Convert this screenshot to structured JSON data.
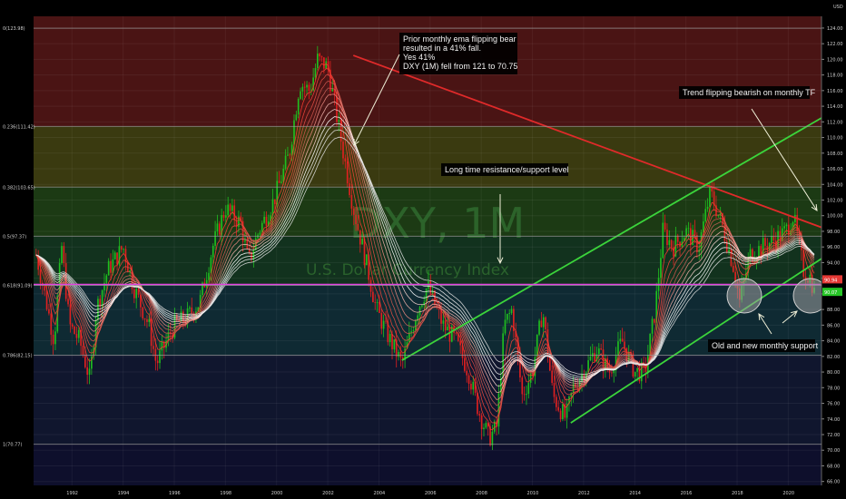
{
  "chart_data": {
    "type": "candlestick",
    "symbol": "DXY, 1M",
    "name": "U.S. Dollar Currency Index",
    "currency": "USD",
    "xlim": [
      1990.5,
      2021.3
    ],
    "ylim": [
      65.5,
      125.5
    ],
    "x_ticks": [
      "1992",
      "1994",
      "1996",
      "1998",
      "2000",
      "2002",
      "2004",
      "2006",
      "2008",
      "2010",
      "2012",
      "2014",
      "2016",
      "2018",
      "2020"
    ],
    "y_ticks": [
      "124.00",
      "122.00",
      "120.00",
      "118.00",
      "116.00",
      "114.00",
      "112.00",
      "110.00",
      "108.00",
      "106.00",
      "104.00",
      "102.00",
      "100.00",
      "98.00",
      "96.00",
      "94.00",
      "92.00",
      "90.00",
      "88.00",
      "86.00",
      "84.00",
      "82.00",
      "80.00",
      "78.00",
      "76.00",
      "74.00",
      "72.00",
      "70.00",
      "68.00",
      "66.00"
    ],
    "fib_levels": [
      {
        "label": "0(123.98)",
        "value": 123.98,
        "color": "#4a1414"
      },
      {
        "label": "0.236(111.42)",
        "value": 111.42,
        "color": "#3a3a10"
      },
      {
        "label": "0.382(103.65)",
        "value": 103.65,
        "color": "#1c3a14"
      },
      {
        "label": "0.5(97.37)",
        "value": 97.37,
        "color": "#12321e"
      },
      {
        "label": "0.618(91.09)",
        "value": 91.09,
        "color": "#0f2a33"
      },
      {
        "label": "0.786(82.15)",
        "value": 82.15,
        "color": "#10162e"
      },
      {
        "label": "1(70.77)",
        "value": 70.77,
        "color": "#0e0f2c"
      }
    ],
    "price_labels": [
      {
        "text": "90.94",
        "color": "#e53935"
      },
      {
        "text": "90.07",
        "color": "#26c626"
      }
    ],
    "close_path": [
      [
        1990.6,
        95
      ],
      [
        1991.0,
        89
      ],
      [
        1991.3,
        84
      ],
      [
        1991.6,
        96
      ],
      [
        1991.9,
        86
      ],
      [
        1992.3,
        84
      ],
      [
        1992.7,
        79
      ],
      [
        1992.95,
        88
      ],
      [
        1993.4,
        93
      ],
      [
        1994.0,
        96
      ],
      [
        1994.4,
        91
      ],
      [
        1995.0,
        86
      ],
      [
        1995.3,
        81
      ],
      [
        1995.7,
        84
      ],
      [
        1996.0,
        86
      ],
      [
        1996.5,
        87
      ],
      [
        1997.0,
        89
      ],
      [
        1997.5,
        96
      ],
      [
        1998.0,
        101
      ],
      [
        1998.6,
        99
      ],
      [
        1998.9,
        94
      ],
      [
        1999.3,
        98
      ],
      [
        1999.9,
        102
      ],
      [
        2000.5,
        108
      ],
      [
        2000.9,
        117
      ],
      [
        2001.3,
        116
      ],
      [
        2001.6,
        120
      ],
      [
        2002.0,
        119
      ],
      [
        2002.5,
        110
      ],
      [
        2003.0,
        101
      ],
      [
        2003.5,
        94
      ],
      [
        2003.9,
        88
      ],
      [
        2004.3,
        85
      ],
      [
        2004.9,
        81
      ],
      [
        2005.5,
        88
      ],
      [
        2005.9,
        91
      ],
      [
        2006.5,
        86
      ],
      [
        2007.0,
        84
      ],
      [
        2007.5,
        80
      ],
      [
        2007.9,
        75
      ],
      [
        2008.3,
        71.5
      ],
      [
        2008.6,
        73
      ],
      [
        2008.9,
        86
      ],
      [
        2009.2,
        88
      ],
      [
        2009.6,
        77
      ],
      [
        2010.0,
        80
      ],
      [
        2010.4,
        88
      ],
      [
        2010.8,
        77
      ],
      [
        2011.3,
        74
      ],
      [
        2011.6,
        78
      ],
      [
        2012.0,
        80
      ],
      [
        2012.5,
        83
      ],
      [
        2013.0,
        80
      ],
      [
        2013.5,
        84
      ],
      [
        2014.0,
        80
      ],
      [
        2014.4,
        80
      ],
      [
        2014.8,
        88
      ],
      [
        2015.1,
        98
      ],
      [
        2015.5,
        96
      ],
      [
        2016.0,
        98
      ],
      [
        2016.5,
        96
      ],
      [
        2016.95,
        103
      ],
      [
        2017.4,
        99
      ],
      [
        2017.9,
        93
      ],
      [
        2018.1,
        89
      ],
      [
        2018.5,
        95
      ],
      [
        2019.0,
        96
      ],
      [
        2019.5,
        97
      ],
      [
        2019.9,
        98
      ],
      [
        2020.2,
        100
      ],
      [
        2020.6,
        93
      ],
      [
        2020.9,
        92
      ],
      [
        2021.0,
        90.1
      ]
    ],
    "annotations": [
      {
        "text": "Prior monthly ema flipping bear"
      },
      {
        "text": "resulted in a 41% fall."
      },
      {
        "text": "Yes 41%"
      },
      {
        "text": "DXY (1M) fell from 121 to 70.75"
      },
      {
        "text": "Trend flipping bearish on monthly TF"
      },
      {
        "text": "Long time resistance/support level"
      },
      {
        "text": "Old and new monthly support"
      }
    ],
    "trendlines": [
      {
        "name": "resistance",
        "color": "#e02a2a",
        "from": [
          2003.0,
          120.5
        ],
        "to": [
          2021.3,
          98.5
        ]
      },
      {
        "name": "channel-upper",
        "color": "#3bd43b",
        "from": [
          2004.9,
          81.5
        ],
        "to": [
          2021.3,
          112.5
        ]
      },
      {
        "name": "channel-lower",
        "color": "#3bd43b",
        "from": [
          2011.5,
          73.5
        ],
        "to": [
          2021.3,
          94.5
        ]
      },
      {
        "name": "horizontal-level",
        "color": "#e040e0",
        "from": [
          1990.5,
          91.2
        ],
        "to": [
          2021.3,
          91.2
        ]
      }
    ],
    "colors": {
      "up": "#1fbf1f",
      "down": "#e02020",
      "background": "#000000"
    }
  }
}
